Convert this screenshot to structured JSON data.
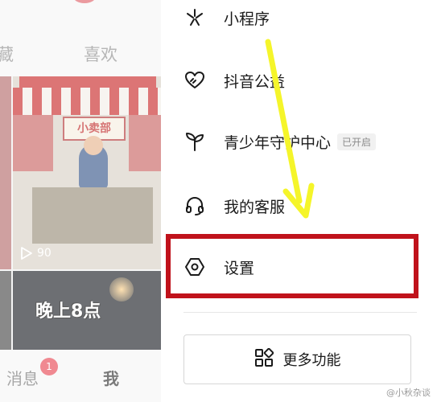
{
  "left_pane": {
    "tabs": {
      "favorites": "藏",
      "likes": "喜欢"
    },
    "thumb1": {
      "shop_sign": "小卖部",
      "views": "90"
    },
    "thumb2": {
      "caption": "晚上8点"
    },
    "bottom_nav": {
      "messages": "消息",
      "messages_badge": "1",
      "me": "我"
    }
  },
  "drawer": {
    "items": [
      {
        "label": "小程序",
        "icon": "sparkle-icon"
      },
      {
        "label": "抖音公益",
        "icon": "heart-hand-icon"
      },
      {
        "label": "青少年守护中心",
        "icon": "sprout-icon",
        "tag": "已开启"
      },
      {
        "label": "我的客服",
        "icon": "headset-icon"
      },
      {
        "label": "设置",
        "icon": "hexagon-gear-icon"
      }
    ],
    "more_button": {
      "label": "更多功能",
      "icon": "grid-icon"
    }
  },
  "annotation": {
    "arrow_color": "#f5f52a",
    "box_color": "#c0121b"
  },
  "watermark": "@小秋杂谈"
}
